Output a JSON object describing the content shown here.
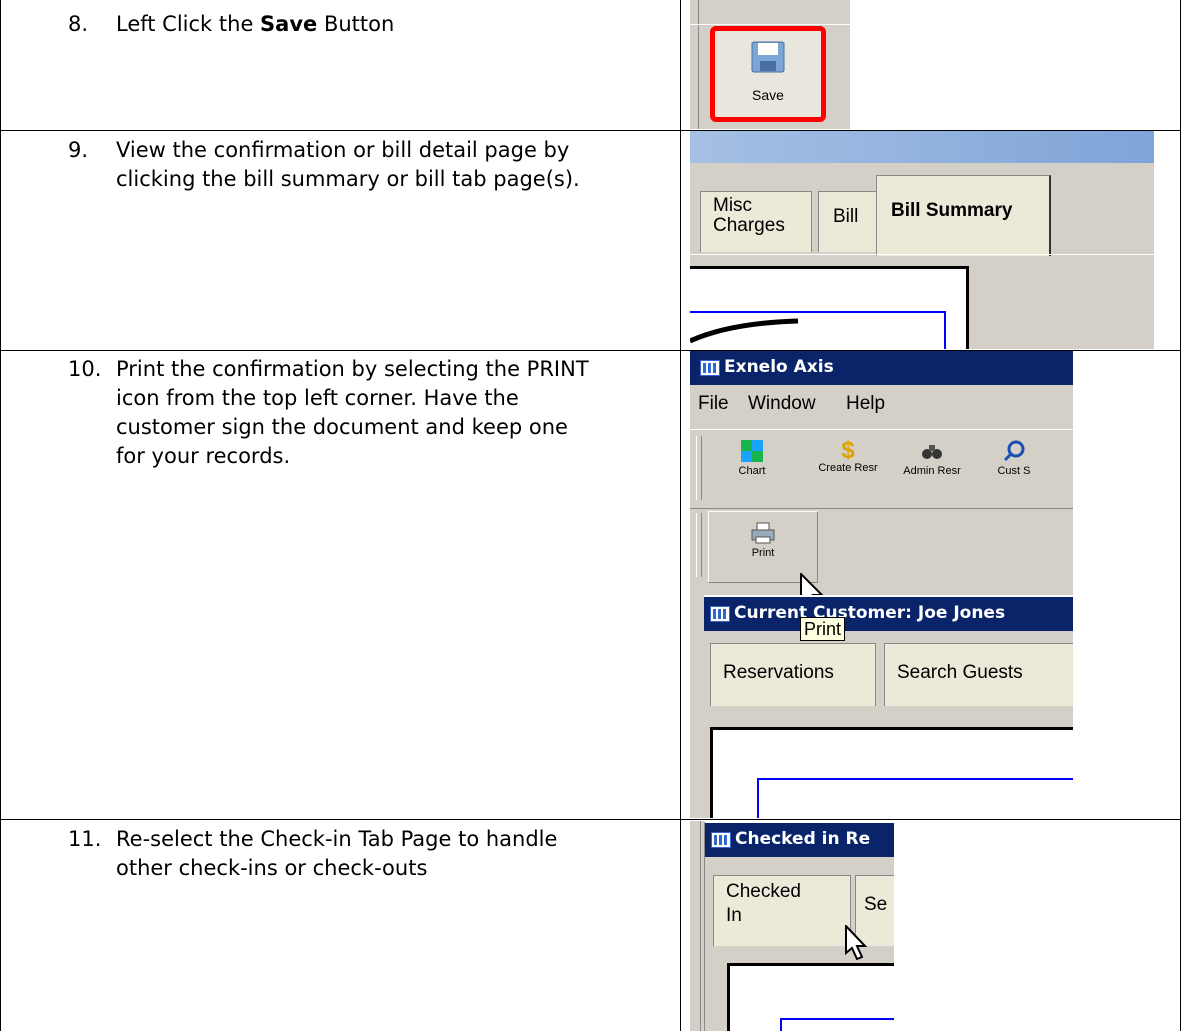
{
  "steps": [
    {
      "num": "8.",
      "pre": "Left Click the ",
      "bold": "Save",
      "post": " Button"
    },
    {
      "num": "9.",
      "text": "View the confirmation or bill detail page by clicking the bill summary or bill tab page(s)."
    },
    {
      "num": "10.",
      "text": "Print the confirmation by selecting the PRINT icon from the top left corner.  Have the customer sign the document and keep one for your records."
    },
    {
      "num": "11.",
      "text": "Re-select the Check-in Tab Page to handle other check-ins or check-outs"
    }
  ],
  "shot8": {
    "save_label": "Save"
  },
  "shot9": {
    "tab_misc_line1": "Misc",
    "tab_misc_line2": "Charges",
    "tab_bill": "Bill",
    "tab_bill_summary": "Bill Summary"
  },
  "shot10": {
    "app_title": "Exnelo Axis",
    "menu": [
      "File",
      "Window",
      "Help"
    ],
    "toolbar": [
      "Chart",
      "Create Resr",
      "Admin Resr",
      "Cust S"
    ],
    "print_label": "Print",
    "tooltip": "Print",
    "customer_title": "Current Customer: Joe Jones",
    "tab_reservations": "Reservations",
    "tab_search_guests": "Search Guests"
  },
  "shot11": {
    "title": "Checked in Re",
    "tab_line1": "Checked",
    "tab_line2": "In",
    "tab_se": "Se"
  },
  "colors": {
    "highlight": "#ff0000",
    "titlebar": "#0a246a",
    "window_bg": "#d4d0c8",
    "blue_frame": "#0000ff"
  }
}
